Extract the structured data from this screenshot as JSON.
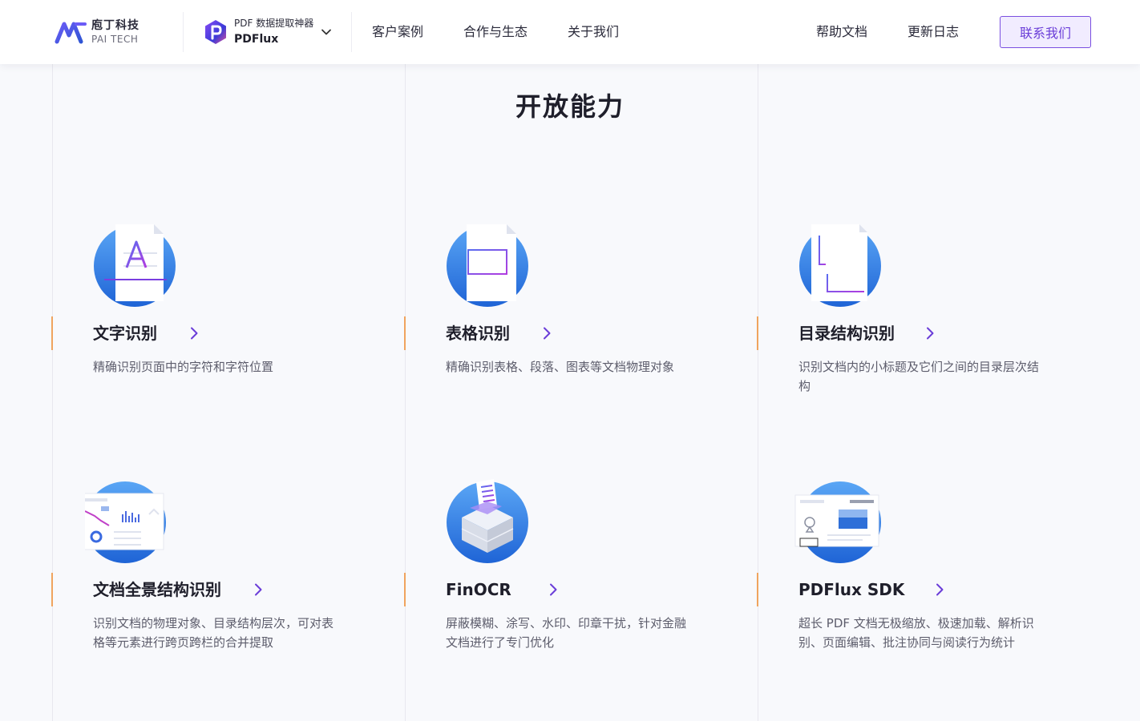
{
  "header": {
    "logo": {
      "cn": "庖丁科技",
      "en": "PAI TECH"
    },
    "product": {
      "tag": "PDF 数据提取神器",
      "name": "PDFlux"
    },
    "nav": [
      "客户案例",
      "合作与生态",
      "关于我们"
    ],
    "right_nav": [
      "帮助文档",
      "更新日志"
    ],
    "contact_label": "联系我们"
  },
  "section": {
    "title": "开放能力",
    "cards": [
      {
        "title": "文字识别",
        "desc": "精确识别页面中的字符和字符位置",
        "icon": "text-recognition-icon"
      },
      {
        "title": "表格识别",
        "desc": "精确识别表格、段落、图表等文档物理对象",
        "icon": "table-recognition-icon"
      },
      {
        "title": "目录结构识别",
        "desc": "识别文档内的小标题及它们之间的目录层次结构",
        "icon": "toc-structure-icon"
      },
      {
        "title": "文档全景结构识别",
        "desc": "识别文档的物理对象、目录结构层次，可对表格等元素进行跨页跨栏的合并提取",
        "icon": "panorama-structure-icon"
      },
      {
        "title": "FinOCR",
        "desc": "屏蔽模糊、涂写、水印、印章干扰，针对金融文档进行了专门优化",
        "icon": "finocr-icon"
      },
      {
        "title": "PDFlux SDK",
        "desc": "超长 PDF 文档无极缩放、极速加载、解析识别、页面编辑、批注协同与阅读行为统计",
        "icon": "pdflux-sdk-icon"
      }
    ]
  },
  "colors": {
    "accent_purple": "#6a3dd8",
    "accent_orange": "#f0a45e",
    "icon_blue": "#2e7fe0",
    "background": "#f8f9fc"
  }
}
